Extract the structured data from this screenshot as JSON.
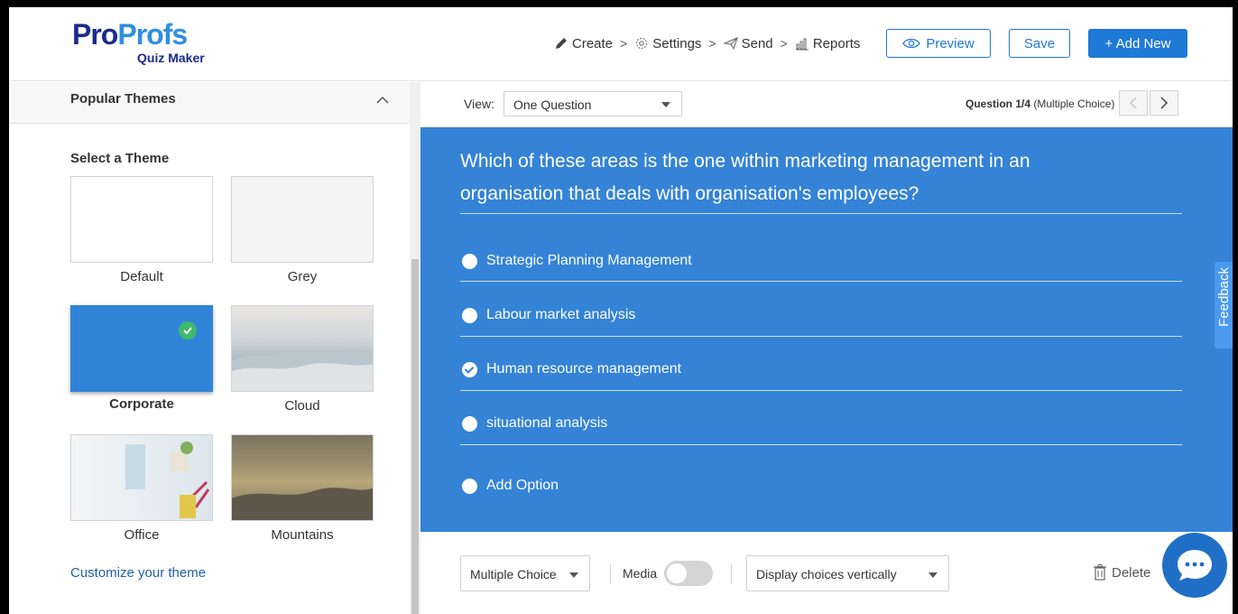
{
  "header": {
    "brand_part1": "Pro",
    "brand_part2": "Profs",
    "brand_sub": "Quiz Maker",
    "nav": [
      {
        "label": "Create",
        "icon": "pencil-icon"
      },
      {
        "label": "Settings",
        "icon": "gear-icon"
      },
      {
        "label": "Send",
        "icon": "paper-plane-icon"
      },
      {
        "label": "Reports",
        "icon": "bar-chart-icon"
      }
    ],
    "nav_separator": ">",
    "preview_label": "Preview",
    "save_label": "Save",
    "add_new_label": "+ Add New"
  },
  "sidebar": {
    "section_title": "Popular Themes",
    "select_title": "Select a Theme",
    "themes": [
      {
        "label": "Default",
        "selected": false
      },
      {
        "label": "Grey",
        "selected": false
      },
      {
        "label": "Corporate",
        "selected": true
      },
      {
        "label": "Cloud",
        "selected": false
      },
      {
        "label": "Office",
        "selected": false
      },
      {
        "label": "Mountains",
        "selected": false
      }
    ],
    "customize_label": "Customize your theme"
  },
  "viewbar": {
    "view_label": "View:",
    "view_value": "One Question",
    "question_counter_bold": "Question 1/4",
    "question_counter_type": "(Multiple Choice)"
  },
  "question": {
    "text": "Which of these areas is the one within marketing management in an organisation that deals with organisation's employees?",
    "options": [
      {
        "label": "Strategic Planning Management",
        "checked": false
      },
      {
        "label": "Labour market analysis",
        "checked": false
      },
      {
        "label": "Human resource management",
        "checked": true
      },
      {
        "label": "situational analysis",
        "checked": false
      }
    ],
    "add_option_label": "Add Option"
  },
  "feedback_tab_label": "Feedback",
  "bottombar": {
    "question_type": "Multiple Choice",
    "media_label": "Media",
    "media_enabled": false,
    "display_value": "Display choices vertically",
    "delete_label": "Delete"
  },
  "colors": {
    "primary": "#1f7ad6",
    "question_bg": "#3483d6",
    "brand_dark": "#1b2a8a",
    "brand_light": "#2e8fe0",
    "selected_check": "#3dbb6a"
  }
}
